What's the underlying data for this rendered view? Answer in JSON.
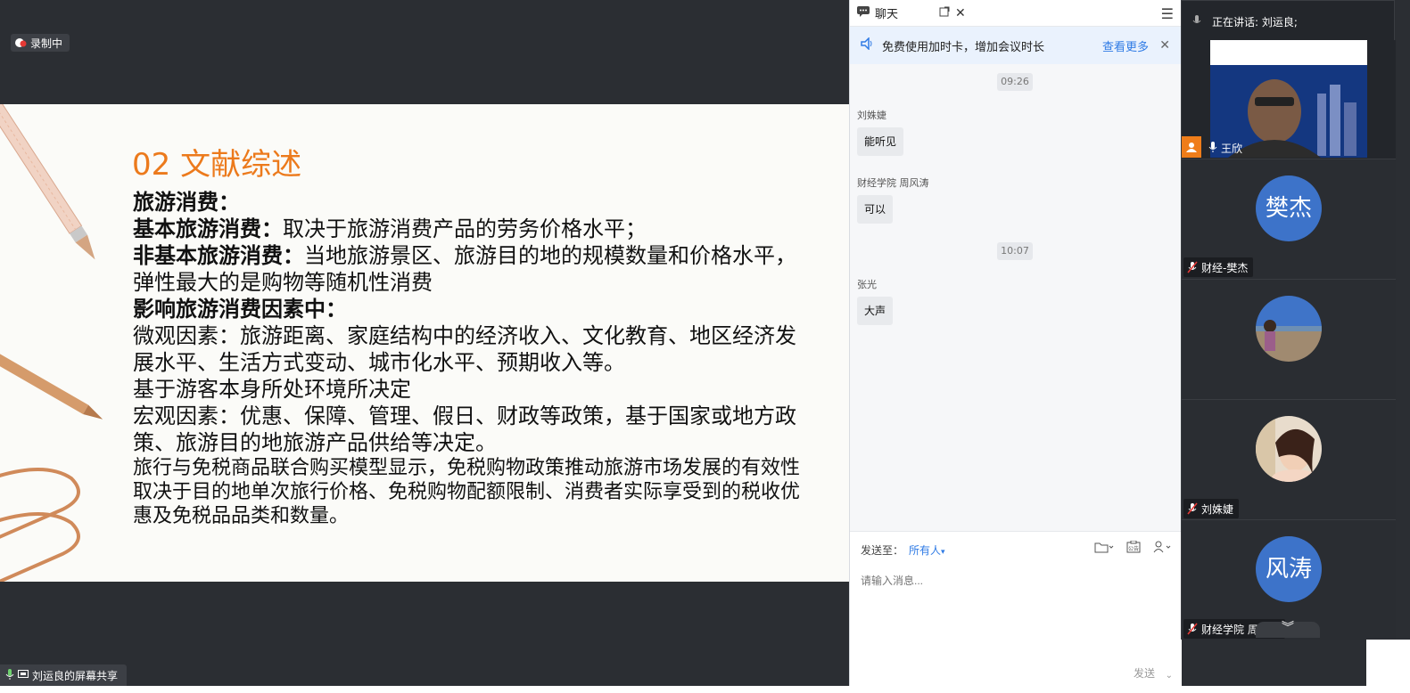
{
  "recording": {
    "label": "录制中"
  },
  "slide": {
    "title": "02 文献综述",
    "lines": [
      {
        "kind": "heading",
        "text": "旅游消费："
      },
      {
        "kind": "mixed",
        "bold": "基本旅游消费：",
        "text": "取决于旅游消费产品的劳务价格水平；"
      },
      {
        "kind": "mixed",
        "bold": "非基本旅游消费：",
        "text": "当地旅游景区、旅游目的地的规模数量和价格水平，弹性最大的是购物等随机性消费"
      },
      {
        "kind": "heading",
        "text": "影响旅游消费因素中："
      },
      {
        "kind": "plain",
        "text": "微观因素：旅游距离、家庭结构中的经济收入、文化教育、地区经济发展水平、生活方式变动、城市化水平、预期收入等。"
      },
      {
        "kind": "plain",
        "text": "基于游客本身所处环境所决定"
      },
      {
        "kind": "plain",
        "text": "宏观因素：优惠、保障、管理、假日、财政等政策，基于国家或地方政策、旅游目的地旅游产品供给等决定。"
      },
      {
        "kind": "small",
        "text": "旅行与免税商品联合购买模型显示，免税购物政策推动旅游市场发展的有效性取决于目的地单次旅行价格、免税购物配额限制、消费者实际享受到的税收优惠及免税品品类和数量。"
      }
    ]
  },
  "share_footer": {
    "label": "刘运良的屏幕共享"
  },
  "chat": {
    "tab_label": "聊天",
    "promo": {
      "text": "免费使用加时卡，增加会议时长",
      "more": "查看更多"
    },
    "timestamps": [
      "09:26",
      "10:07"
    ],
    "messages": [
      {
        "sender": "刘姝婕",
        "text": "能听见"
      },
      {
        "sender": "财经学院 周风涛",
        "text": "可以"
      },
      {
        "sender": "张光",
        "text": "大声"
      }
    ],
    "send_to_label": "发送至：",
    "send_to_value": "所有人",
    "input_placeholder": "请输入消息...",
    "send_label": "发送"
  },
  "videos": {
    "speaking_label": "正在讲话:",
    "speaking_name": "刘运良;",
    "tiles": [
      {
        "name": "王欣",
        "type": "video"
      },
      {
        "name": "财经-樊杰",
        "avatar_text": "樊杰",
        "type": "avatar"
      },
      {
        "name": "",
        "type": "photo"
      },
      {
        "name": "刘姝婕",
        "type": "photo"
      },
      {
        "name": "财经学院 周风涛",
        "avatar_text": "风涛",
        "type": "avatar"
      }
    ]
  },
  "colors": {
    "accent": "#2f7be5",
    "slide_title": "#ec7a1c",
    "avatar": "#3d73c9"
  }
}
